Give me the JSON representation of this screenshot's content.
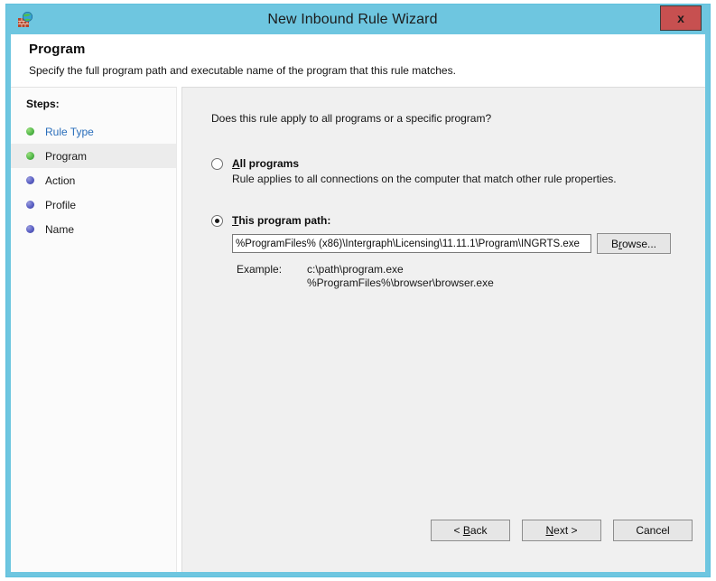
{
  "window": {
    "title": "New Inbound Rule Wizard",
    "icon": "firewall-globe-icon",
    "close_label": "x",
    "frame_color": "#6ec6e0",
    "close_color": "#c75050"
  },
  "header": {
    "title": "Program",
    "subtitle": "Specify the full program path and executable name of the program that this rule matches."
  },
  "sidebar": {
    "heading": "Steps:",
    "items": [
      {
        "label": "Rule Type",
        "state": "completed",
        "bullet": "green",
        "style": "link"
      },
      {
        "label": "Program",
        "state": "current",
        "bullet": "green",
        "style": "plain"
      },
      {
        "label": "Action",
        "state": "pending",
        "bullet": "purple",
        "style": "plain"
      },
      {
        "label": "Profile",
        "state": "pending",
        "bullet": "purple",
        "style": "plain"
      },
      {
        "label": "Name",
        "state": "pending",
        "bullet": "purple",
        "style": "plain"
      }
    ]
  },
  "main": {
    "question": "Does this rule apply to all programs or a specific program?",
    "options": [
      {
        "id": "all-programs",
        "accel": "A",
        "label_rest": "ll programs",
        "description": "Rule applies to all connections on the computer that match other rule properties.",
        "selected": false
      },
      {
        "id": "this-program-path",
        "accel": "T",
        "label_rest": "his program path:",
        "description": "",
        "selected": true
      }
    ],
    "path_field": {
      "value": "%ProgramFiles% (x86)\\Intergraph\\Licensing\\11.11.1\\Program\\INGRTS.exe",
      "placeholder": ""
    },
    "browse_button": {
      "pre": "B",
      "accel": "r",
      "post": "owse..."
    },
    "example": {
      "label": "Example:",
      "lines": [
        "c:\\path\\program.exe",
        "%ProgramFiles%\\browser\\browser.exe"
      ]
    }
  },
  "footer": {
    "back": {
      "pre": "< ",
      "accel": "B",
      "post": "ack"
    },
    "next": {
      "pre": "",
      "accel": "N",
      "post": "ext >"
    },
    "cancel": {
      "pre": "",
      "accel": "",
      "post": "Cancel"
    }
  }
}
